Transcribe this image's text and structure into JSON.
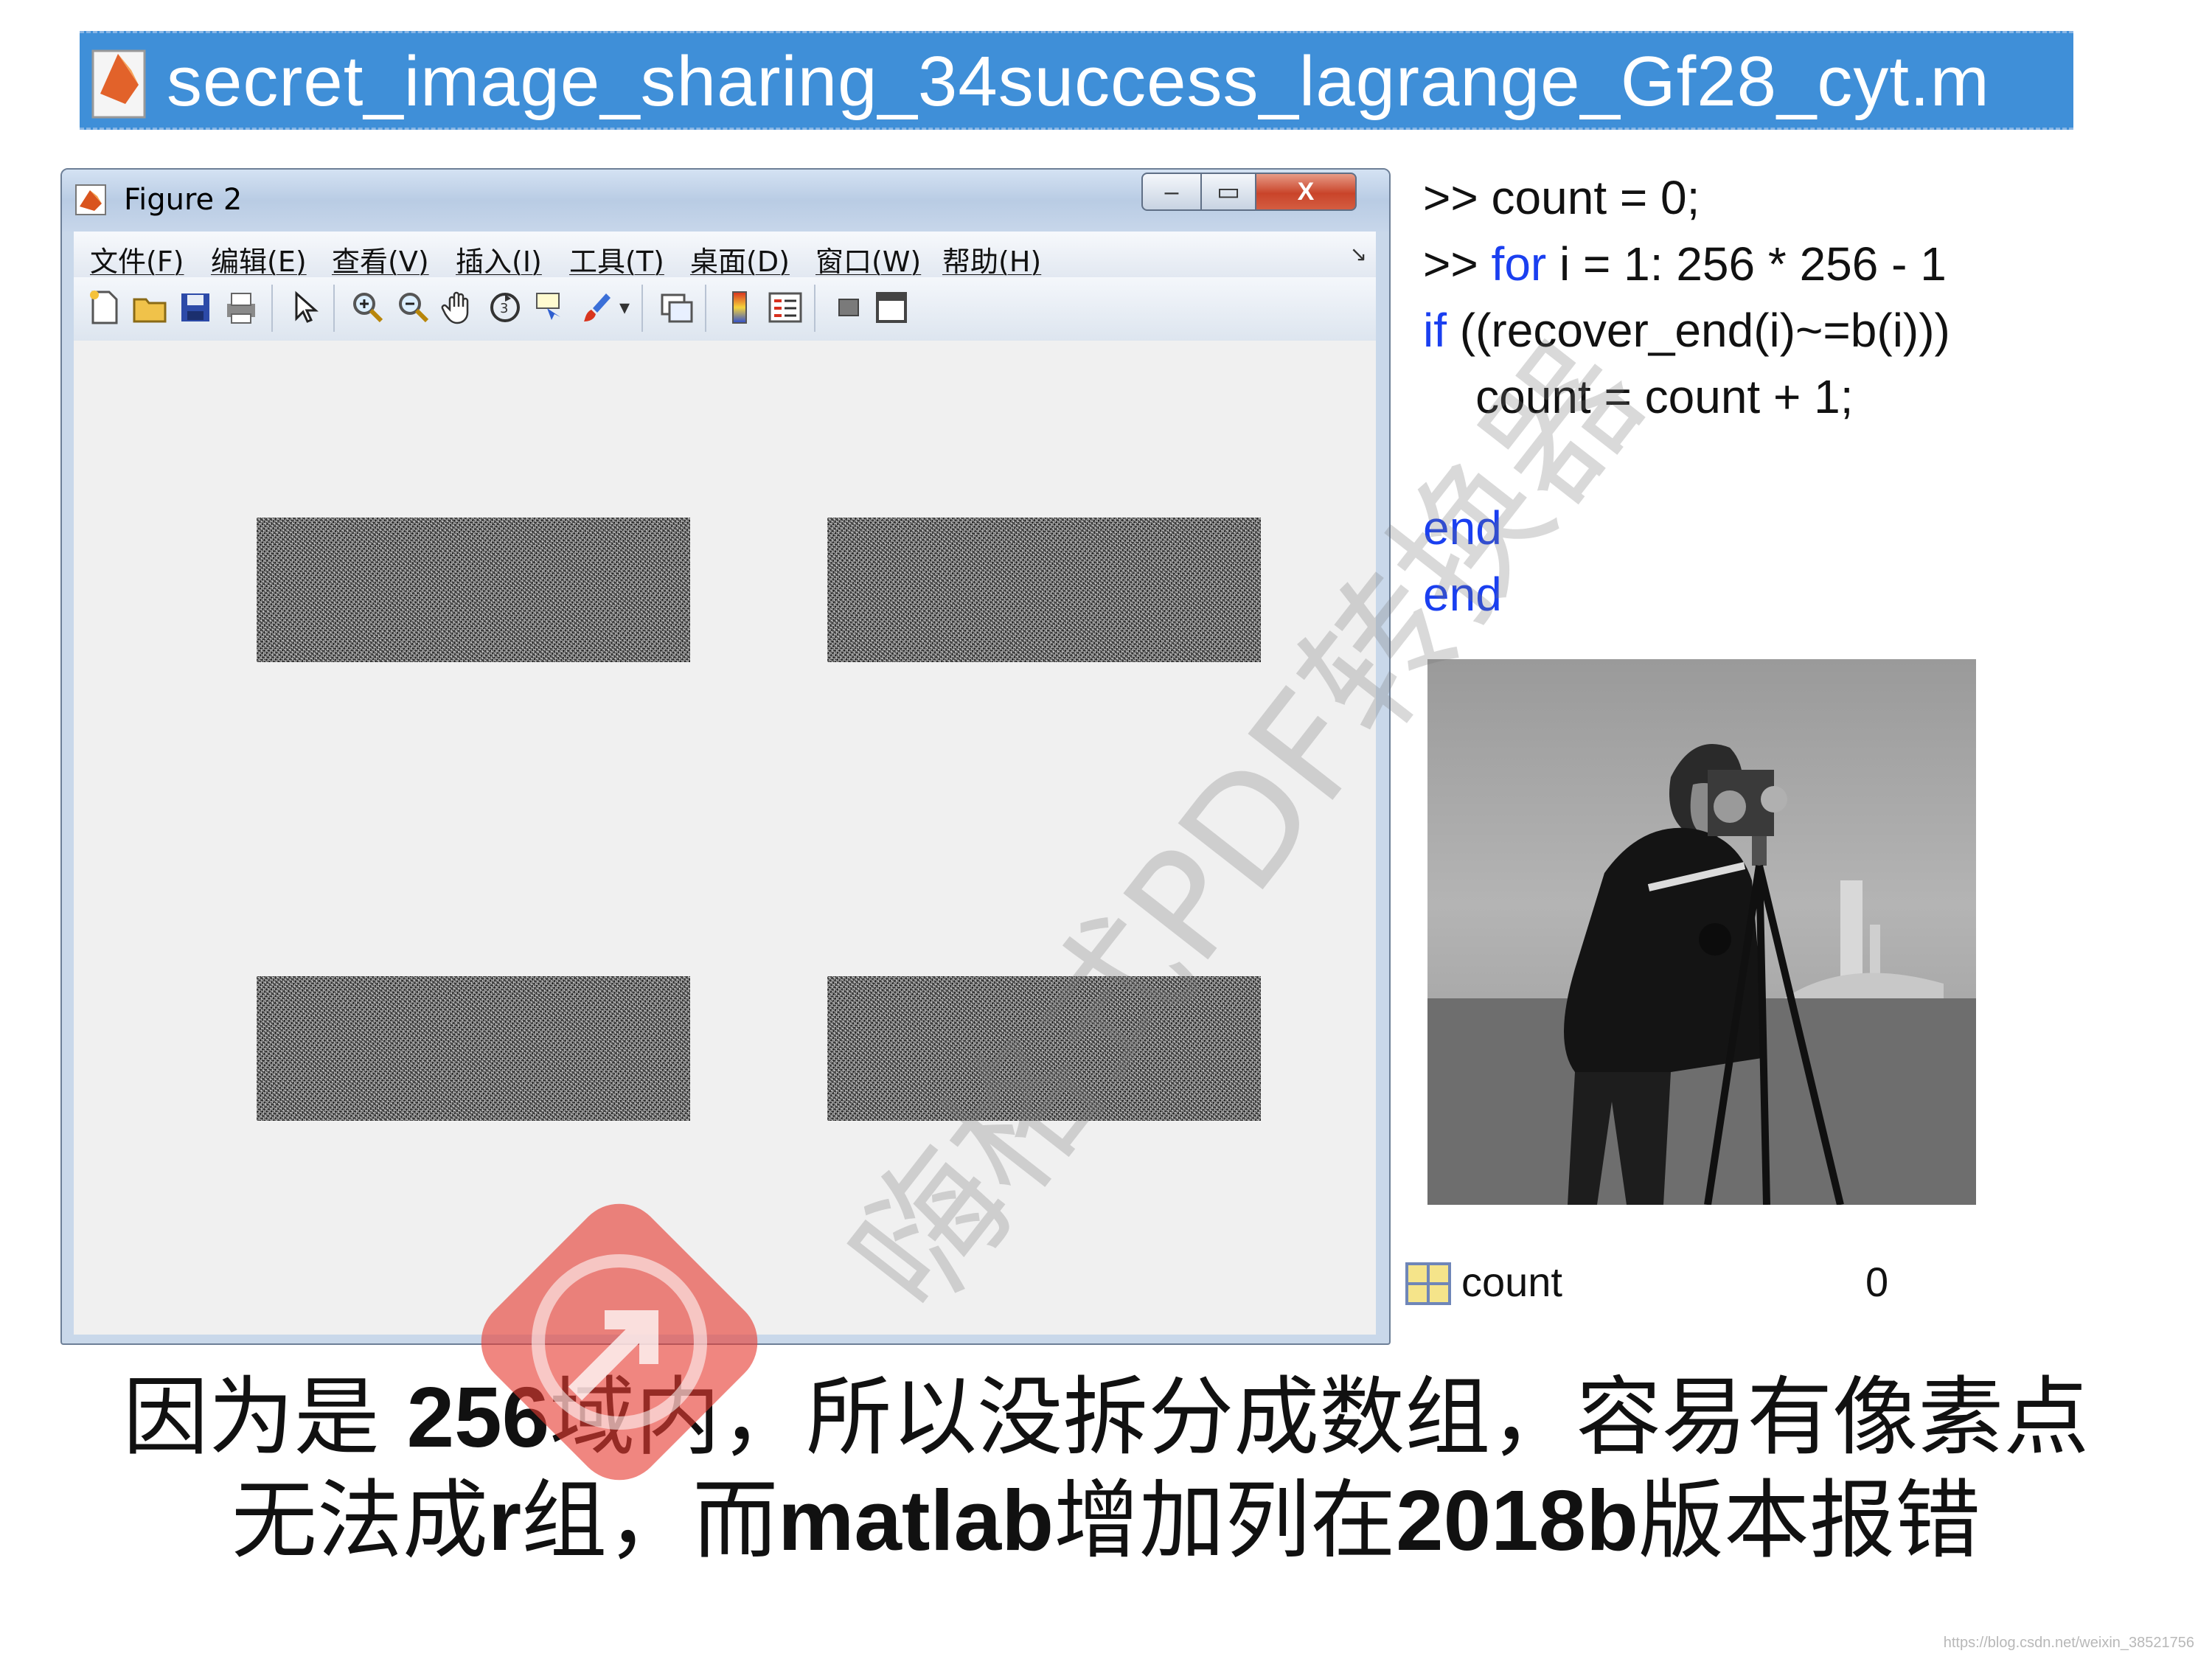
{
  "file_title": "secret_image_sharing_34success_lagrange_Gf28_cyt.m",
  "figure_window": {
    "title": "Figure 2",
    "menu": [
      "文件(F)",
      "编辑(E)",
      "查看(V)",
      "插入(I)",
      "工具(T)",
      "桌面(D)",
      "窗口(W)",
      "帮助(H)"
    ],
    "toolbar_icons": [
      "new-file-icon",
      "open-folder-icon",
      "save-icon",
      "print-icon",
      "pointer-icon",
      "zoom-in-icon",
      "zoom-out-icon",
      "pan-hand-icon",
      "rotate-3d-icon",
      "data-cursor-icon",
      "brush-icon",
      "link-plot-icon",
      "colorbar-icon",
      "legend-icon",
      "hide-plot-tools-icon",
      "show-plot-tools-icon"
    ],
    "controls": {
      "min": "–",
      "max": "▭",
      "close": "X"
    }
  },
  "code": {
    "line1": ">> count = 0;",
    "line2_prompt": ">> ",
    "line2_kw": "for",
    "line2_rest": " i = 1: 256 * 256 - 1",
    "line3_kw": "if",
    "line3_rest": " ((recover_end(i)~=b(i)))",
    "line4": "    count = count + 1;",
    "line5": "end",
    "line6": "end"
  },
  "workspace": {
    "var_name": "count",
    "var_value": "0"
  },
  "caption": {
    "l1_a": "因为是 ",
    "l1_b": "256",
    "l1_c": "域内，所以没拆分成数组，容易有像素点",
    "l2_a": "无法成",
    "l2_b": "r",
    "l2_c": "组，而",
    "l2_d": "matlab",
    "l2_e": "增加列在",
    "l2_f": "2018b",
    "l2_g": "版本报错"
  },
  "watermark": "嗨格式PDF转换器",
  "credit": "https://blog.csdn.net/weixin_38521756",
  "colors": {
    "title_bar": "#3f8fd8",
    "keyword": "#1a3ff0",
    "close_button": "#c9442a"
  }
}
